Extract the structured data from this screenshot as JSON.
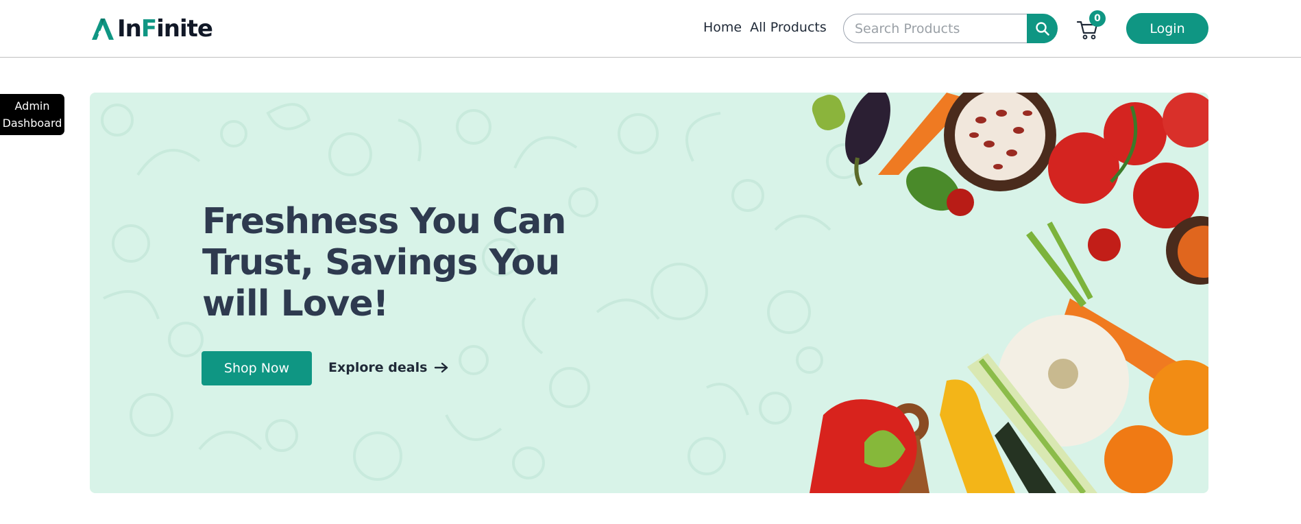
{
  "brand": {
    "name_prefix": "In",
    "name_accent": "F",
    "name_suffix": "inite",
    "accent_color": "#0f9683"
  },
  "nav": {
    "home": "Home",
    "all_products": "All Products"
  },
  "search": {
    "placeholder": "Search Products",
    "icon": "search-icon"
  },
  "cart": {
    "icon": "cart-icon",
    "count": "0"
  },
  "header": {
    "login_label": "Login"
  },
  "admin": {
    "line1": "Admin",
    "line2": "Dashboard"
  },
  "hero": {
    "title_line1": "Freshness You Can",
    "title_line2": "Trust, Savings You",
    "title_line3": "will Love!",
    "shop_label": "Shop Now",
    "explore_label": "Explore deals",
    "background_color": "#d8f3e8"
  }
}
